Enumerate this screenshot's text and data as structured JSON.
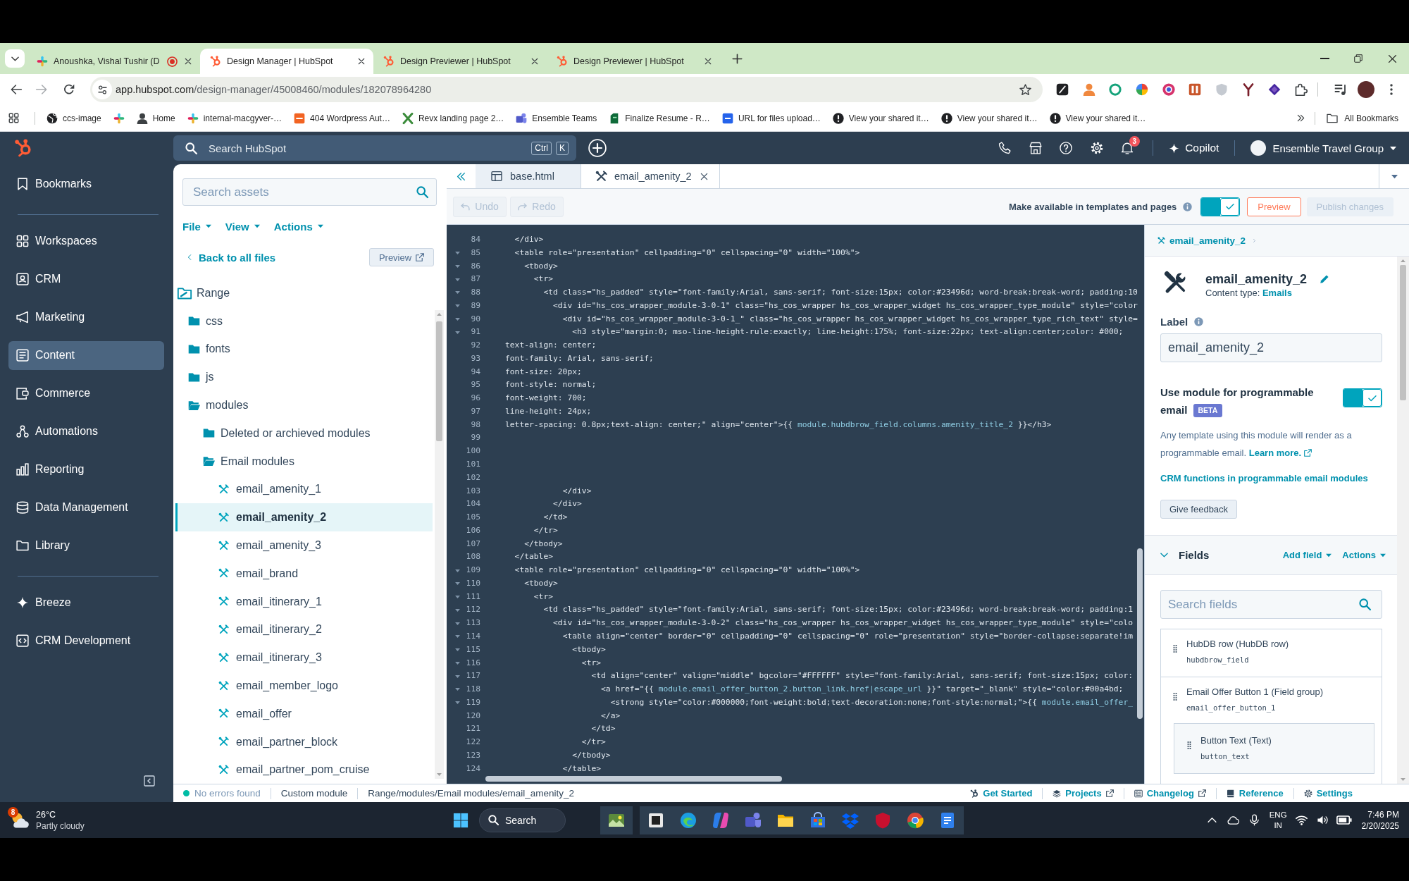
{
  "browser": {
    "tabs": [
      {
        "title": "Anoushka, Vishal Tushir (D",
        "selected": false,
        "recording": true
      },
      {
        "title": "Design Manager | HubSpot",
        "selected": true,
        "recording": false
      },
      {
        "title": "Design Previewer | HubSpot",
        "selected": false,
        "recording": false
      },
      {
        "title": "Design Previewer | HubSpot",
        "selected": false,
        "recording": false
      }
    ],
    "url": {
      "host": "app.hubspot.com",
      "path": "/design-manager/45008460/modules/182078964280"
    },
    "bookmarks": [
      {
        "kind": "link",
        "label": "ccs-image"
      },
      {
        "kind": "icon"
      },
      {
        "kind": "link",
        "label": "Home"
      },
      {
        "kind": "link",
        "label": "internal-macgyver-…"
      },
      {
        "kind": "link",
        "label": "404 Wordpress Aut…"
      },
      {
        "kind": "link",
        "label": "Revx landing page 2…"
      },
      {
        "kind": "link",
        "label": "Ensemble Teams"
      },
      {
        "kind": "link",
        "label": "Finalize Resume - R…"
      },
      {
        "kind": "link",
        "label": "URL for files upload…"
      },
      {
        "kind": "link",
        "label": "View your shared it…"
      },
      {
        "kind": "link",
        "label": "View your shared it…"
      },
      {
        "kind": "link",
        "label": "View your shared it…"
      }
    ],
    "all_bookmarks": "All Bookmarks"
  },
  "hubspot_nav": {
    "search_placeholder": "Search HubSpot",
    "shortcut": [
      "Ctrl",
      "K"
    ],
    "notification_count": "3",
    "copilot": "Copilot",
    "account": "Ensemble Travel Group"
  },
  "sidebar": {
    "groups": [
      {
        "items": [
          {
            "label": "Bookmarks",
            "selected": false
          }
        ]
      },
      {
        "items": [
          {
            "label": "Workspaces",
            "selected": false
          },
          {
            "label": "CRM",
            "selected": false
          },
          {
            "label": "Marketing",
            "selected": false
          },
          {
            "label": "Content",
            "selected": true
          },
          {
            "label": "Commerce",
            "selected": false
          },
          {
            "label": "Automations",
            "selected": false
          },
          {
            "label": "Reporting",
            "selected": false
          },
          {
            "label": "Data Management",
            "selected": false
          },
          {
            "label": "Library",
            "selected": false
          }
        ]
      },
      {
        "items": [
          {
            "label": "Breeze",
            "selected": false
          },
          {
            "label": "CRM Development",
            "selected": false
          }
        ]
      }
    ]
  },
  "file_panel": {
    "search_placeholder": "Search assets",
    "menus": [
      "File",
      "View",
      "Actions"
    ],
    "back_link": "Back to all files",
    "preview_button": "Preview",
    "tree": {
      "label": "Range",
      "kind": "root",
      "expanded": true,
      "selected": false,
      "children": [
        {
          "label": "css",
          "kind": "folder",
          "expanded": false,
          "selected": false
        },
        {
          "label": "fonts",
          "kind": "folder",
          "expanded": false,
          "selected": false
        },
        {
          "label": "js",
          "kind": "folder",
          "expanded": false,
          "selected": false
        },
        {
          "label": "modules",
          "kind": "folder",
          "expanded": true,
          "selected": false,
          "children": [
            {
              "label": "Deleted or archieved modules",
              "kind": "folder",
              "expanded": false,
              "selected": false
            },
            {
              "label": "Email modules",
              "kind": "folder",
              "expanded": true,
              "selected": false,
              "children": [
                {
                  "label": "email_amenity_1",
                  "kind": "module",
                  "selected": false
                },
                {
                  "label": "email_amenity_2",
                  "kind": "module",
                  "selected": true
                },
                {
                  "label": "email_amenity_3",
                  "kind": "module",
                  "selected": false
                },
                {
                  "label": "email_brand",
                  "kind": "module",
                  "selected": false
                },
                {
                  "label": "email_itinerary_1",
                  "kind": "module",
                  "selected": false
                },
                {
                  "label": "email_itinerary_2",
                  "kind": "module",
                  "selected": false
                },
                {
                  "label": "email_itinerary_3",
                  "kind": "module",
                  "selected": false
                },
                {
                  "label": "email_member_logo",
                  "kind": "module",
                  "selected": false
                },
                {
                  "label": "email_offer",
                  "kind": "module",
                  "selected": false
                },
                {
                  "label": "email_partner_block",
                  "kind": "module",
                  "selected": false
                },
                {
                  "label": "email_partner_pom_cruise",
                  "kind": "module",
                  "selected": false
                }
              ]
            }
          ]
        }
      ]
    }
  },
  "editor": {
    "tabs": [
      {
        "label": "base.html",
        "kind": "template",
        "selected": false,
        "closable": false
      },
      {
        "label": "email_amenity_2",
        "kind": "module",
        "selected": true,
        "closable": true
      }
    ],
    "undo": {
      "label": "Undo",
      "disabled": true
    },
    "redo": {
      "label": "Redo",
      "disabled": true
    },
    "availability": {
      "label": "Make available in templates and pages",
      "on": true
    },
    "preview_button": "Preview",
    "publish": {
      "label": "Publish changes",
      "disabled": true
    },
    "code_lines": [
      {
        "number": "84",
        "foldable": false,
        "parts": [
          {
            "kind": "code",
            "text": "  </div>"
          }
        ]
      },
      {
        "number": "85",
        "foldable": true,
        "parts": [
          {
            "kind": "code",
            "text": "  <table role=\"presentation\" cellpadding=\"0\" cellspacing=\"0\" width=\"100%\">"
          }
        ]
      },
      {
        "number": "86",
        "foldable": true,
        "parts": [
          {
            "kind": "code",
            "text": "    <tbody>"
          }
        ]
      },
      {
        "number": "87",
        "foldable": true,
        "parts": [
          {
            "kind": "code",
            "text": "      <tr>"
          }
        ]
      },
      {
        "number": "88",
        "foldable": true,
        "parts": [
          {
            "kind": "code",
            "text": "        <td class=\"hs_padded\" style=\"font-family:Arial, sans-serif; font-size:15px; color:#23496d; word-break:break-word; padding:10"
          }
        ]
      },
      {
        "number": "89",
        "foldable": true,
        "parts": [
          {
            "kind": "code",
            "text": "          <div id=\"hs_cos_wrapper_module-3-0-1\" class=\"hs_cos_wrapper hs_cos_wrapper_widget hs_cos_wrapper_type_module\" style=\"color"
          }
        ]
      },
      {
        "number": "90",
        "foldable": true,
        "parts": [
          {
            "kind": "code",
            "text": "            <div id=\"hs_cos_wrapper_module-3-0-1_\" class=\"hs_cos_wrapper hs_cos_wrapper_widget hs_cos_wrapper_type_rich_text\" style="
          }
        ]
      },
      {
        "number": "91",
        "foldable": true,
        "parts": [
          {
            "kind": "code",
            "text": "              <h3 style=\"margin:0; mso-line-height-rule:exactly; line-height:175%; font-size:22px; text-align:center;color: #000;"
          }
        ]
      },
      {
        "number": "92",
        "foldable": false,
        "parts": [
          {
            "kind": "code",
            "text": "text-align: center;"
          }
        ]
      },
      {
        "number": "93",
        "foldable": false,
        "parts": [
          {
            "kind": "code",
            "text": "font-family: Arial, sans-serif;"
          }
        ]
      },
      {
        "number": "94",
        "foldable": false,
        "parts": [
          {
            "kind": "code",
            "text": "font-size: 20px;"
          }
        ]
      },
      {
        "number": "95",
        "foldable": false,
        "parts": [
          {
            "kind": "code",
            "text": "font-style: normal;"
          }
        ]
      },
      {
        "number": "96",
        "foldable": false,
        "parts": [
          {
            "kind": "code",
            "text": "font-weight: 700;"
          }
        ]
      },
      {
        "number": "97",
        "foldable": false,
        "parts": [
          {
            "kind": "code",
            "text": "line-height: 24px;"
          }
        ]
      },
      {
        "number": "98",
        "foldable": false,
        "parts": [
          {
            "kind": "code",
            "text": "letter-spacing: 0.8px;text-align: center;\" align=\"center\">{{ "
          },
          {
            "kind": "variable",
            "text": "module.hubdbrow_field.columns.amenity_title_2"
          },
          {
            "kind": "code",
            "text": " }}</h3>"
          }
        ]
      },
      {
        "number": "99",
        "foldable": false
      },
      {
        "number": "100",
        "foldable": false
      },
      {
        "number": "101",
        "foldable": false
      },
      {
        "number": "102",
        "foldable": false
      },
      {
        "number": "103",
        "foldable": false,
        "parts": [
          {
            "kind": "code",
            "text": "            </div>"
          }
        ]
      },
      {
        "number": "104",
        "foldable": false,
        "parts": [
          {
            "kind": "code",
            "text": "          </div>"
          }
        ]
      },
      {
        "number": "105",
        "foldable": false,
        "parts": [
          {
            "kind": "code",
            "text": "        </td>"
          }
        ]
      },
      {
        "number": "106",
        "foldable": false,
        "parts": [
          {
            "kind": "code",
            "text": "      </tr>"
          }
        ]
      },
      {
        "number": "107",
        "foldable": false,
        "parts": [
          {
            "kind": "code",
            "text": "    </tbody>"
          }
        ]
      },
      {
        "number": "108",
        "foldable": false,
        "parts": [
          {
            "kind": "code",
            "text": "  </table>"
          }
        ]
      },
      {
        "number": "109",
        "foldable": true,
        "parts": [
          {
            "kind": "code",
            "text": "  <table role=\"presentation\" cellpadding=\"0\" cellspacing=\"0\" width=\"100%\">"
          }
        ]
      },
      {
        "number": "110",
        "foldable": true,
        "parts": [
          {
            "kind": "code",
            "text": "    <tbody>"
          }
        ]
      },
      {
        "number": "111",
        "foldable": true,
        "parts": [
          {
            "kind": "code",
            "text": "      <tr>"
          }
        ]
      },
      {
        "number": "112",
        "foldable": true,
        "parts": [
          {
            "kind": "code",
            "text": "        <td class=\"hs_padded\" style=\"font-family:Arial, sans-serif; font-size:15px; color:#23496d; word-break:break-word; padding:1"
          }
        ]
      },
      {
        "number": "113",
        "foldable": true,
        "parts": [
          {
            "kind": "code",
            "text": "          <div id=\"hs_cos_wrapper_module-3-0-2\" class=\"hs_cos_wrapper hs_cos_wrapper_widget hs_cos_wrapper_type_module\" style=\"colo"
          }
        ]
      },
      {
        "number": "114",
        "foldable": true,
        "parts": [
          {
            "kind": "code",
            "text": "            <table align=\"center\" border=\"0\" cellpadding=\"0\" cellspacing=\"0\" role=\"presentation\" style=\"border-collapse:separate!im"
          }
        ]
      },
      {
        "number": "115",
        "foldable": true,
        "parts": [
          {
            "kind": "code",
            "text": "              <tbody>"
          }
        ]
      },
      {
        "number": "116",
        "foldable": true,
        "parts": [
          {
            "kind": "code",
            "text": "                <tr>"
          }
        ]
      },
      {
        "number": "117",
        "foldable": true,
        "parts": [
          {
            "kind": "code",
            "text": "                  <td align=\"center\" valign=\"middle\" bgcolor=\"#FFFFFF\" style=\"font-family:Arial, sans-serif; font-size:15px; color:"
          }
        ]
      },
      {
        "number": "118",
        "foldable": true,
        "parts": [
          {
            "kind": "code",
            "text": "                    <a href=\"{{ "
          },
          {
            "kind": "variable",
            "text": "module.email_offer_button_2.button_link.href|escape_url"
          },
          {
            "kind": "code",
            "text": " }}\" target=\"_blank\" style=\"color:#00a4bd;"
          }
        ]
      },
      {
        "number": "119",
        "foldable": true,
        "parts": [
          {
            "kind": "code",
            "text": "                      <strong style=\"color:#000000;font-weight:bold;text-decoration:none;font-style:normal;\">{{ "
          },
          {
            "kind": "variable",
            "text": "module.email_offer_"
          }
        ]
      },
      {
        "number": "120",
        "foldable": false,
        "parts": [
          {
            "kind": "code",
            "text": "                    </a>"
          }
        ]
      },
      {
        "number": "121",
        "foldable": false,
        "parts": [
          {
            "kind": "code",
            "text": "                  </td>"
          }
        ]
      },
      {
        "number": "122",
        "foldable": false,
        "parts": [
          {
            "kind": "code",
            "text": "                </tr>"
          }
        ]
      },
      {
        "number": "123",
        "foldable": false,
        "parts": [
          {
            "kind": "code",
            "text": "              </tbody>"
          }
        ]
      },
      {
        "number": "124",
        "foldable": false,
        "parts": [
          {
            "kind": "code",
            "text": "            </table>"
          }
        ]
      }
    ]
  },
  "module_panel": {
    "breadcrumb": "email_amenity_2",
    "title": "email_amenity_2",
    "content_type_label": "Content type:",
    "content_type": "Emails",
    "label_heading": "Label",
    "label_value": "email_amenity_2",
    "programmable": {
      "label": "Use module for programmable email",
      "badge": "BETA",
      "on": true
    },
    "description": "Any template using this module will render as a programmable email.",
    "learn_more": "Learn more.",
    "crm_link": "CRM functions in programmable email modules",
    "feedback_button": "Give feedback",
    "fields": {
      "title": "Fields",
      "expanded": true,
      "add_field": "Add field",
      "actions": "Actions",
      "search_placeholder": "Search fields",
      "items": [
        {
          "label": "HubDB row (HubDB row)",
          "name": "hubdbrow_field"
        },
        {
          "label": "Email Offer Button 1 (Field group)",
          "name": "email_offer_button_1",
          "children": [
            {
              "label": "Button Text (Text)",
              "name": "button_text"
            }
          ]
        }
      ]
    }
  },
  "status_bar": {
    "status": "No errors found",
    "type": "Custom module",
    "path": "Range/modules/Email modules/email_amenity_2",
    "links": [
      {
        "label": "Get Started",
        "external": false
      },
      {
        "label": "Projects",
        "external": true
      },
      {
        "label": "Changelog",
        "external": true
      },
      {
        "label": "Reference",
        "external": false
      },
      {
        "label": "Settings",
        "external": false
      }
    ]
  },
  "taskbar": {
    "weather": {
      "alert_count": "8",
      "temperature": "26°C",
      "condition": "Partly cloudy"
    },
    "search_placeholder": "Search",
    "language": "ENG",
    "region": "IN",
    "time": "7:46 PM",
    "date": "2/20/2025"
  }
}
